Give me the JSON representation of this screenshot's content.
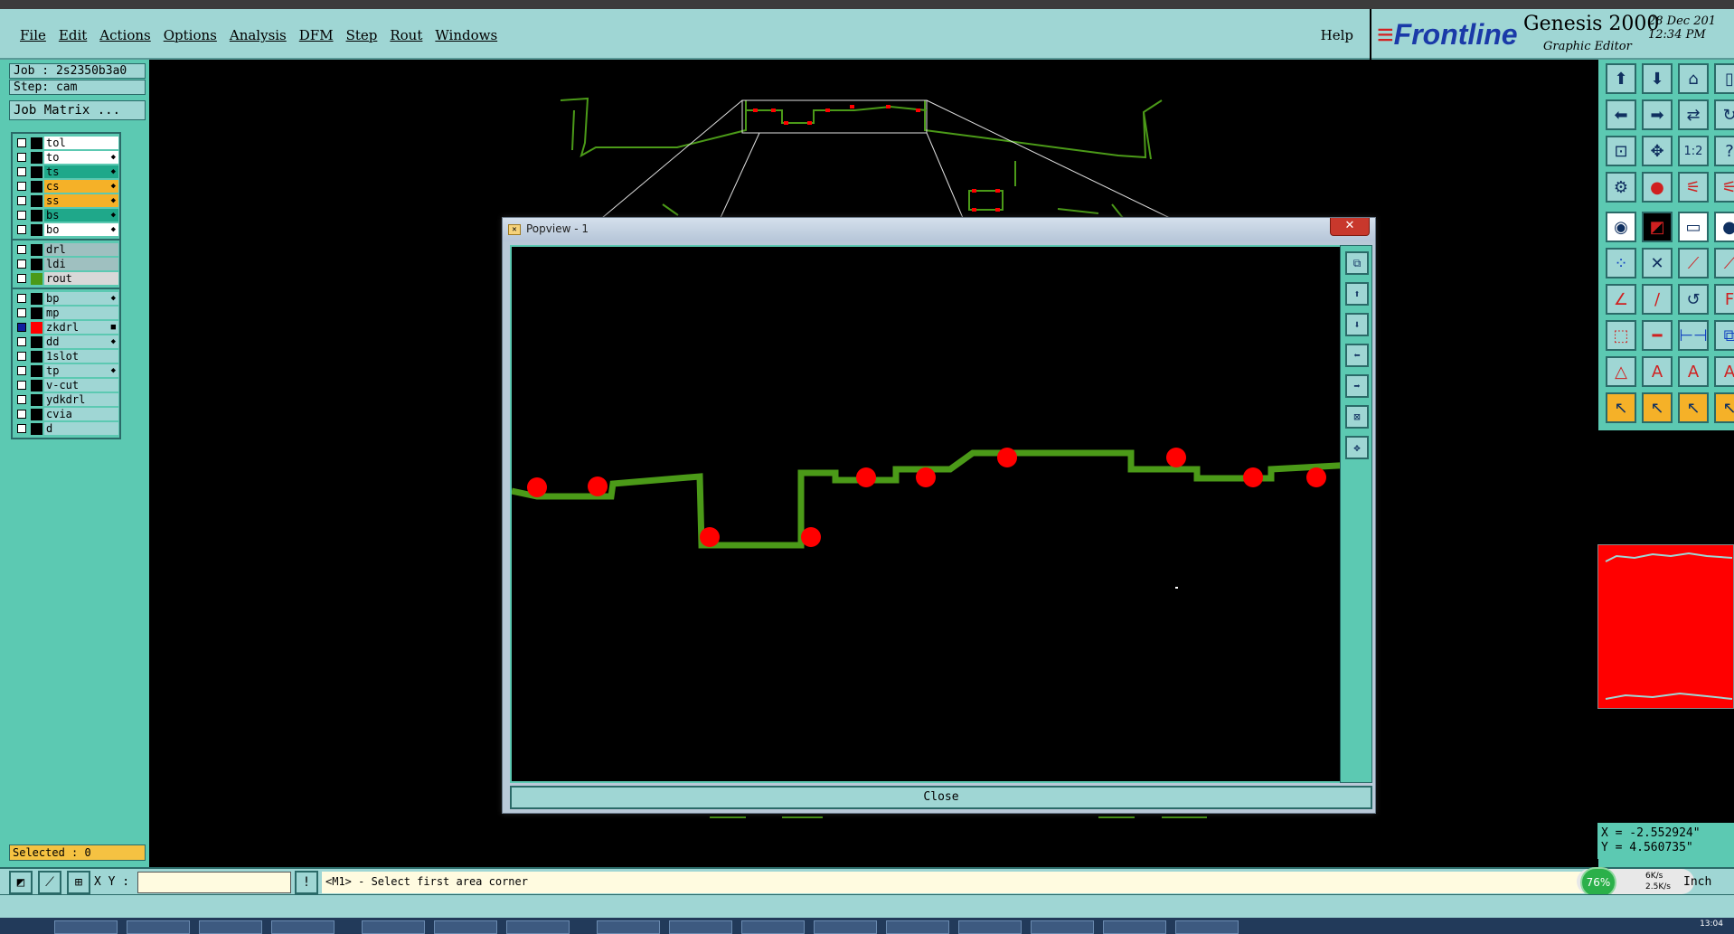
{
  "menu": {
    "items": [
      "File",
      "Edit",
      "Actions",
      "Options",
      "Analysis",
      "DFM",
      "Step",
      "Rout",
      "Windows"
    ],
    "help": "Help"
  },
  "brand": {
    "logo": "Frontline",
    "product": "Genesis 2000",
    "subtitle": "Graphic Editor",
    "date": "28 Dec 201",
    "time": "12:34 PM"
  },
  "left": {
    "job": "Job : 2s2350b3a0",
    "step": "Step: cam",
    "job_matrix": "Job Matrix ...",
    "layers_board": [
      "tol",
      "to",
      "ts",
      "cs",
      "ss",
      "bs",
      "bo"
    ],
    "layers_drill": [
      "drl",
      "ldi",
      "rout"
    ],
    "layers_misc": [
      "bp",
      "mp",
      "zkdrl",
      "dd",
      "1slot",
      "tp",
      "v-cut",
      "ydkdrl",
      "cvia",
      "d"
    ],
    "selected": "Selected : 0"
  },
  "popview": {
    "title": "Popview - 1",
    "close_label": "Close"
  },
  "coords": {
    "x": "X = -2.552924\"",
    "y": "Y = 4.560735\""
  },
  "bottom": {
    "xy_label": "X Y :",
    "xy_value": "",
    "prompt": "<M1> - Select first area corner",
    "unit": "Inch",
    "net_pct": "76%",
    "up_speed": "6K/s",
    "down_speed": "2.5K/s",
    "clock": "13:04"
  },
  "colors": {
    "panel": "#5cc9b2",
    "light": "#9fd6d4",
    "trace": "#4b9a18",
    "pad": "#ff0000"
  }
}
